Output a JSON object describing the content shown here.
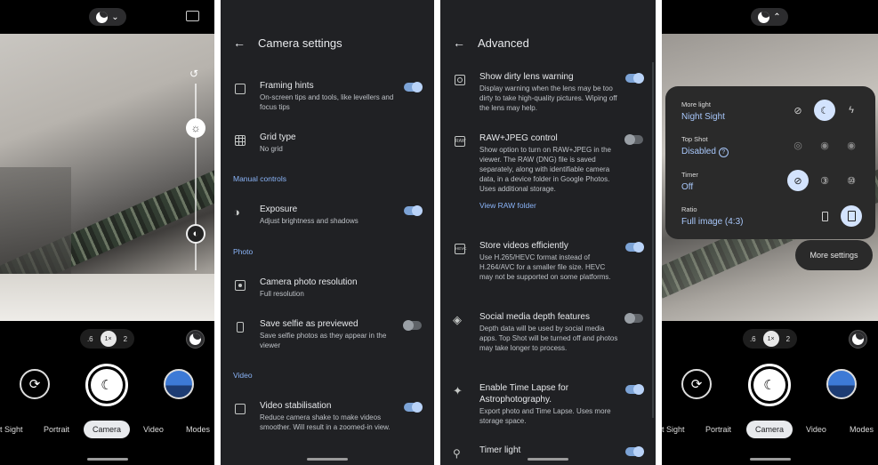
{
  "camera_left": {
    "zoom_levels": [
      ".6",
      "1×",
      "2"
    ],
    "modes": [
      "t Sight",
      "Portrait",
      "Camera",
      "Video",
      "Modes"
    ],
    "active_mode": "Camera"
  },
  "camera_settings": {
    "title": "Camera settings",
    "items": [
      {
        "title": "Framing hints",
        "desc": "On-screen tips and tools, like levellers and focus tips",
        "toggle": "on"
      },
      {
        "title": "Grid type",
        "desc": "No grid"
      },
      {
        "title": "Exposure",
        "desc": "Adjust brightness and shadows",
        "toggle": "on"
      },
      {
        "title": "Camera photo resolution",
        "desc": "Full resolution"
      },
      {
        "title": "Save selfie as previewed",
        "desc": "Save selfie photos as they appear in the viewer",
        "toggle": "off"
      },
      {
        "title": "Video stabilisation",
        "desc": "Reduce camera shake to make videos smoother. Will result in a zoomed-in view.",
        "toggle": "on"
      }
    ],
    "sections": [
      "Manual controls",
      "Photo",
      "Video"
    ]
  },
  "advanced": {
    "title": "Advanced",
    "items": [
      {
        "title": "Show dirty lens warning",
        "desc": "Display warning when the lens may be too dirty to take high-quality pictures. Wiping off the lens may help.",
        "toggle": "on"
      },
      {
        "title": "RAW+JPEG control",
        "desc": "Show option to turn on RAW+JPEG in the viewer. The RAW (DNG) file is saved separately, along with identifiable camera data, in a device folder in Google Photos. Uses additional storage.",
        "link": "View RAW folder",
        "toggle": "off"
      },
      {
        "title": "Store videos efficiently",
        "desc": "Use H.265/HEVC format instead of H.264/AVC for a smaller file size. HEVC may not be supported on some platforms.",
        "toggle": "on"
      },
      {
        "title": "Social media depth features",
        "desc": "Depth data will be used by social media apps. Top Shot will be turned off and photos may take longer to process.",
        "toggle": "off"
      },
      {
        "title": "Enable Time Lapse for Astrophotography.",
        "desc": "Export photo and Time Lapse. Uses more storage space.",
        "toggle": "on"
      },
      {
        "title": "Timer light",
        "desc": "",
        "toggle": "on"
      }
    ],
    "raw_badge": "RAW",
    "hevc_badge": "HEVC"
  },
  "camera_right": {
    "popup": {
      "more_light": {
        "label": "More light",
        "value": "Night Sight"
      },
      "top_shot": {
        "label": "Top Shot",
        "value": "Disabled"
      },
      "timer": {
        "label": "Timer",
        "value": "Off"
      },
      "ratio": {
        "label": "Ratio",
        "value": "Full image (4:3)"
      }
    },
    "more_settings": "More settings",
    "zoom_levels": [
      ".6",
      "1×",
      "2"
    ],
    "modes": [
      "t Sight",
      "Portrait",
      "Camera",
      "Video",
      "Modes"
    ],
    "active_mode": "Camera"
  },
  "colors": {
    "accent": "#8ab4f8",
    "toggle_on": "#7ca3d6",
    "panel_bg": "#202124"
  }
}
